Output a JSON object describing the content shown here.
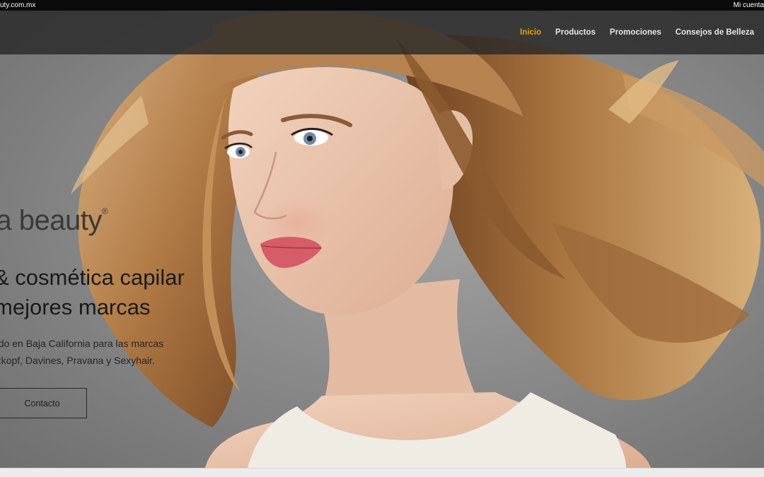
{
  "topbar": {
    "site_text": "uty.com.mx",
    "account_text": "Mi cuenta"
  },
  "nav": {
    "items": [
      {
        "label": "Inicio",
        "active": true
      },
      {
        "label": "Productos",
        "active": false
      },
      {
        "label": "Promociones",
        "active": false
      },
      {
        "label": "Consejos de Belleza",
        "active": false
      }
    ]
  },
  "hero": {
    "brand": "ja beauty",
    "brand_mark": "®",
    "headline_line1": "& cosmética capilar",
    "headline_line2": "mejores marcas",
    "subtext_line1": "ado en Baja California para las marcas",
    "subtext_line2": "rzkopf, Davines, Pravana y Sexyhair.",
    "button_label": "Contacto"
  },
  "colors": {
    "nav_active": "#e3a300",
    "nav_text": "#e6e6e6",
    "topbar_bg": "#0a0a0a"
  }
}
